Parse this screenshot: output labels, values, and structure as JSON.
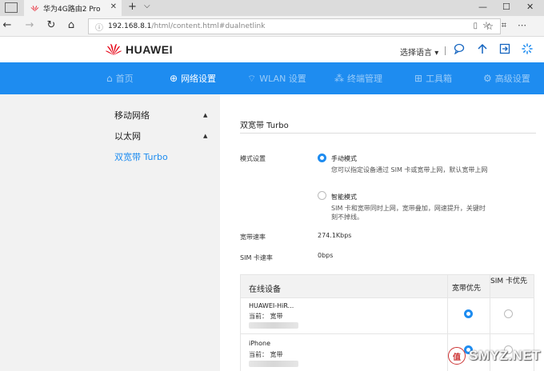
{
  "browser": {
    "tab_title": "华为4G路由2 Pro",
    "tab_close": "✕",
    "new_tab": "+",
    "tab_menu": "⌵",
    "url_host": "192.168.8.1",
    "url_path": "/html/content.html#dualnetlink",
    "win_min": "—",
    "win_max": "☐",
    "win_close": "✕"
  },
  "header": {
    "brand": "HUAWEI",
    "language": "选择语言",
    "language_arrow": "▾"
  },
  "nav": {
    "items": [
      {
        "icon": "⌂",
        "label": "首页"
      },
      {
        "icon": "⊕",
        "label": "网络设置"
      },
      {
        "icon": "⌔",
        "label": "WLAN 设置"
      },
      {
        "icon": "⁂",
        "label": "终端管理"
      },
      {
        "icon": "⊞",
        "label": "工具箱"
      },
      {
        "icon": "⚙",
        "label": "高级设置"
      }
    ]
  },
  "sidebar": {
    "items": [
      {
        "label": "移动网络",
        "arrow": "▲"
      },
      {
        "label": "以太网",
        "arrow": "▲"
      },
      {
        "label": "双宽带 Turbo"
      }
    ]
  },
  "main": {
    "title": "双宽带 Turbo",
    "mode_label": "模式设置",
    "manual_title": "手动模式",
    "manual_desc": "您可以指定设备通过 SIM 卡或宽带上网，默认宽带上网",
    "smart_title": "智能模式",
    "smart_desc": "SIM 卡和宽带同时上网，宽带叠加，网速提升，关键时刻不掉线。",
    "broadband_speed_label": "宽带速率",
    "broadband_speed_value": "274.1Kbps",
    "sim_speed_label": "SIM 卡速率",
    "sim_speed_value": "0bps",
    "table": {
      "col_device": "在线设备",
      "col_broadband": "宽带优先",
      "col_sim": "SIM 卡优先",
      "rows": [
        {
          "name": "HUAWEI-HiR...",
          "current": "当前：  宽带",
          "priority": "broadband"
        },
        {
          "name": "iPhone",
          "current": "当前：  宽带",
          "priority": "broadband"
        }
      ]
    }
  },
  "watermark": {
    "badge": "值",
    "text": "SMYZ.NET"
  },
  "colors": {
    "accent": "#1e8cf0",
    "sidebar_bg": "#f2f2f2",
    "brand_red": "#e60012"
  }
}
